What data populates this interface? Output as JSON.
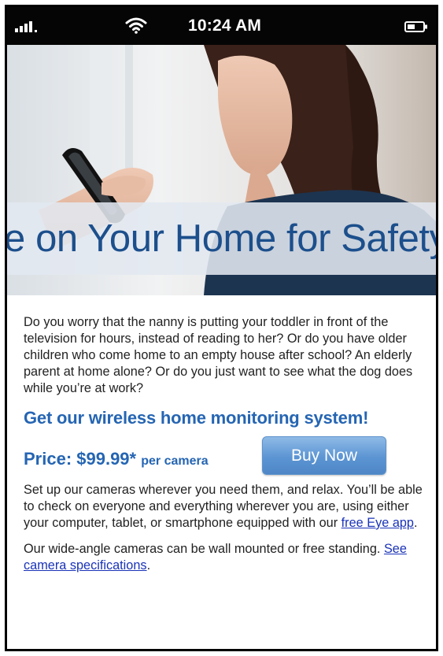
{
  "status_bar": {
    "time": "10:24 AM",
    "signal_icon": "signal-bars-icon",
    "wifi_icon": "wifi-icon",
    "battery_icon": "battery-icon"
  },
  "hero": {
    "headline": "e on Your Home for Safety"
  },
  "intro_paragraph": "Do you worry that the nanny is putting your toddler in front of the television for hours, instead of reading to her?  Or do you have older children who come home to an empty house after school?  An elderly parent at home alone?  Or do you just want to see what the dog does while you’re at work?",
  "cta_heading": "Get our wireless home monitoring system!",
  "price": {
    "label": "Price: $99.99*",
    "unit": "per camera"
  },
  "buy_button_label": "Buy Now",
  "setup_paragraph": {
    "text": "Set up our cameras wherever you need them, and relax. You’ll be able to check on everyone and everything wherever you are, using either your computer, tablet, or smartphone equipped with our ",
    "link_text": "free Eye app",
    "suffix": "."
  },
  "cameras_paragraph": {
    "text": "Our wide-angle cameras can be wall mounted or free standing.  ",
    "link_text": "See camera specifications",
    "suffix": "."
  },
  "colors": {
    "headline": "#1c4f8c",
    "accent": "#2565b3",
    "button": "#5c95d3",
    "link": "#1a33b8"
  }
}
